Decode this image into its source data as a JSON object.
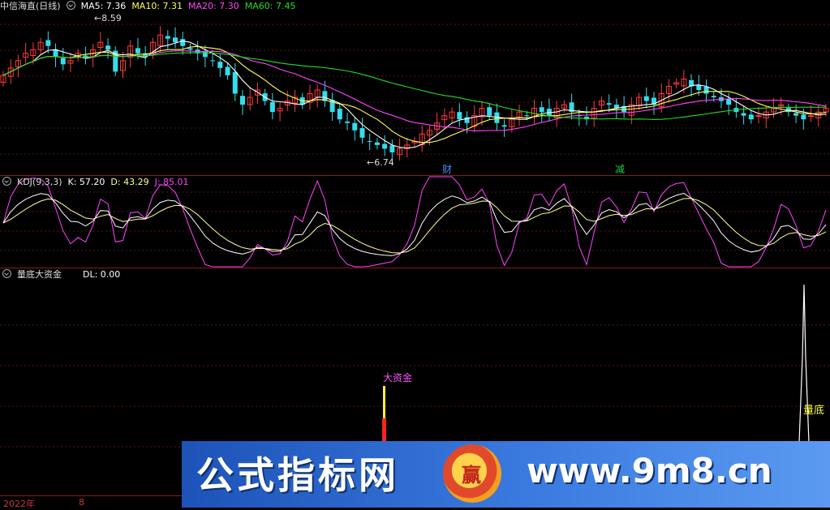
{
  "price_panel": {
    "title": "中信海直(日线)",
    "ma": [
      {
        "label": "MA5: 7.36",
        "color": "#ffffff"
      },
      {
        "label": "MA10: 7.31",
        "color": "#ffff55"
      },
      {
        "label": "MA20: 7.30",
        "color": "#ff44ff"
      },
      {
        "label": "MA60: 7.45",
        "color": "#22dd22"
      }
    ],
    "high_label": "8.59",
    "low_label": "6.74",
    "marker_cai": "财",
    "marker_jian": "减"
  },
  "kdj_panel": {
    "title": "KDJ(9,3,3)",
    "k": "K: 57.20",
    "d": "D: 43.29",
    "j": "J: 85.01"
  },
  "dl_panel": {
    "title": "量底大资金",
    "dl": "DL: 0.00",
    "annotation_big": "大资金",
    "annotation_bottom": "量底"
  },
  "xaxis": {
    "year_label": "2022年",
    "month_label": "8"
  },
  "watermark": {
    "text_cn": "公式指标网",
    "url": "www.9m8.cn",
    "logo_text": "赢"
  },
  "chart_data": [
    {
      "type": "candlestick",
      "title": "中信海直(日线)",
      "ylim": [
        6.6,
        8.7
      ],
      "annotations": [
        {
          "text": "8.59",
          "kind": "high"
        },
        {
          "text": "6.74",
          "kind": "low"
        }
      ],
      "series_ma": [
        {
          "name": "MA5",
          "last": 7.36
        },
        {
          "name": "MA10",
          "last": 7.31
        },
        {
          "name": "MA20",
          "last": 7.3
        },
        {
          "name": "MA60",
          "last": 7.45
        }
      ],
      "close": [
        7.85,
        7.95,
        8.05,
        8.15,
        8.2,
        8.3,
        8.25,
        8.1,
        8.0,
        8.05,
        8.15,
        8.1,
        8.2,
        8.3,
        8.2,
        7.9,
        8.05,
        8.25,
        8.15,
        8.1,
        8.3,
        8.4,
        8.35,
        8.3,
        8.25,
        8.2,
        8.15,
        8.1,
        8.05,
        7.95,
        7.85,
        7.6,
        7.45,
        7.55,
        7.65,
        7.5,
        7.35,
        7.4,
        7.5,
        7.55,
        7.45,
        7.6,
        7.65,
        7.5,
        7.35,
        7.25,
        7.2,
        7.1,
        7.0,
        6.95,
        6.9,
        6.85,
        6.8,
        6.85,
        6.9,
        6.95,
        7.05,
        7.1,
        7.2,
        7.3,
        7.35,
        7.25,
        7.2,
        7.3,
        7.4,
        7.3,
        7.2,
        7.15,
        7.25,
        7.35,
        7.3,
        7.4,
        7.35,
        7.3,
        7.4,
        7.45,
        7.35,
        7.3,
        7.25,
        7.4,
        7.5,
        7.45,
        7.4,
        7.35,
        7.45,
        7.55,
        7.5,
        7.45,
        7.6,
        7.7,
        7.75,
        7.8,
        7.7,
        7.65,
        7.6,
        7.55,
        7.5,
        7.45,
        7.35,
        7.3,
        7.25,
        7.3,
        7.35,
        7.4,
        7.45,
        7.35,
        7.3,
        7.25,
        7.3,
        7.35,
        7.4
      ]
    },
    {
      "type": "line",
      "title": "KDJ(9,3,3)",
      "series": [
        {
          "name": "K",
          "last": 57.2
        },
        {
          "name": "D",
          "last": 43.29
        },
        {
          "name": "J",
          "last": 85.01
        }
      ],
      "ylim": [
        -10,
        110
      ]
    },
    {
      "type": "bar",
      "title": "量底大资金",
      "series": [
        {
          "name": "DL",
          "last": 0.0
        }
      ],
      "annotations": [
        {
          "text": "大资金"
        },
        {
          "text": "量底"
        }
      ]
    }
  ]
}
